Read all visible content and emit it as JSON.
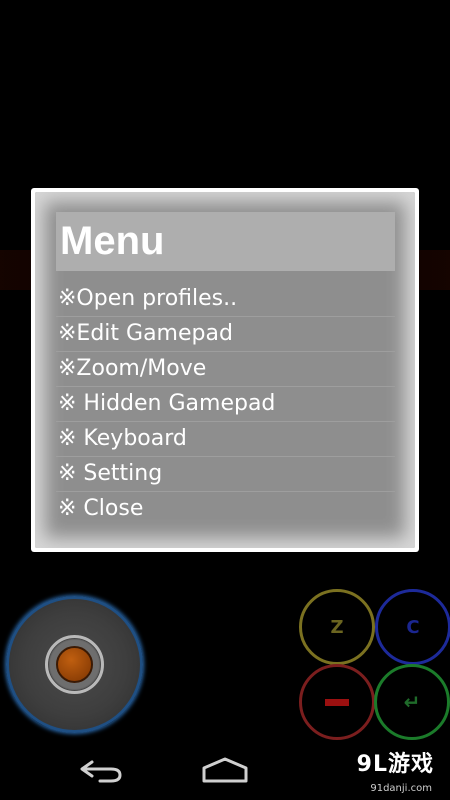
{
  "menu": {
    "title": "Menu",
    "items": [
      {
        "label": "※Open profiles.."
      },
      {
        "label": "※Edit Gamepad"
      },
      {
        "label": "※Zoom/Move"
      },
      {
        "label": "※ Hidden Gamepad"
      },
      {
        "label": "※ Keyboard"
      },
      {
        "label": "※ Setting"
      },
      {
        "label": "※ Close"
      }
    ]
  },
  "gamepad": {
    "buttons": {
      "z_label": "Z",
      "c_label": "C",
      "enter_label": "↵"
    },
    "colors": {
      "joystick_ring": "#1f4f83",
      "knob_core": "#c05f10",
      "z_ring": "#7b7120",
      "c_ring": "#1d2a9a",
      "minus_ring": "#7b1e1e",
      "enter_ring": "#1b7b2a"
    }
  },
  "nav": {
    "icons": [
      "back-icon",
      "home-icon"
    ]
  },
  "watermark": {
    "brand": "9L游戏",
    "url": "91danji.com"
  }
}
